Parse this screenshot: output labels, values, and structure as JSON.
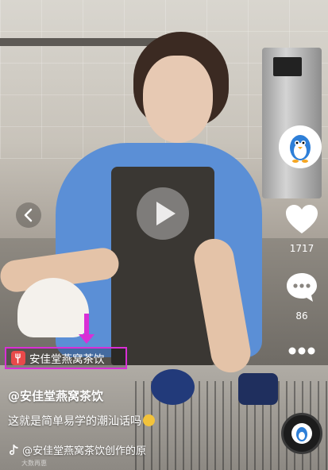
{
  "video": {
    "location_tag": "安佳堂燕窝茶饮",
    "username": "@安佳堂燕窝茶饮",
    "caption": "这就是简单易学的潮汕话吗",
    "music": "@安佳堂燕窝茶饮创作的原",
    "watermark": "大数再惠"
  },
  "actions": {
    "like_count": "1717",
    "comment_count": "86"
  },
  "icons": {
    "back": "chevron-left-icon",
    "play": "play-icon",
    "like": "heart-icon",
    "comment": "comment-icon",
    "more": "more-dots-icon",
    "music": "tiktok-note-icon",
    "location": "fork-icon"
  },
  "colors": {
    "highlight": "#d92fd6",
    "location_icon_bg": "#e8494a"
  }
}
